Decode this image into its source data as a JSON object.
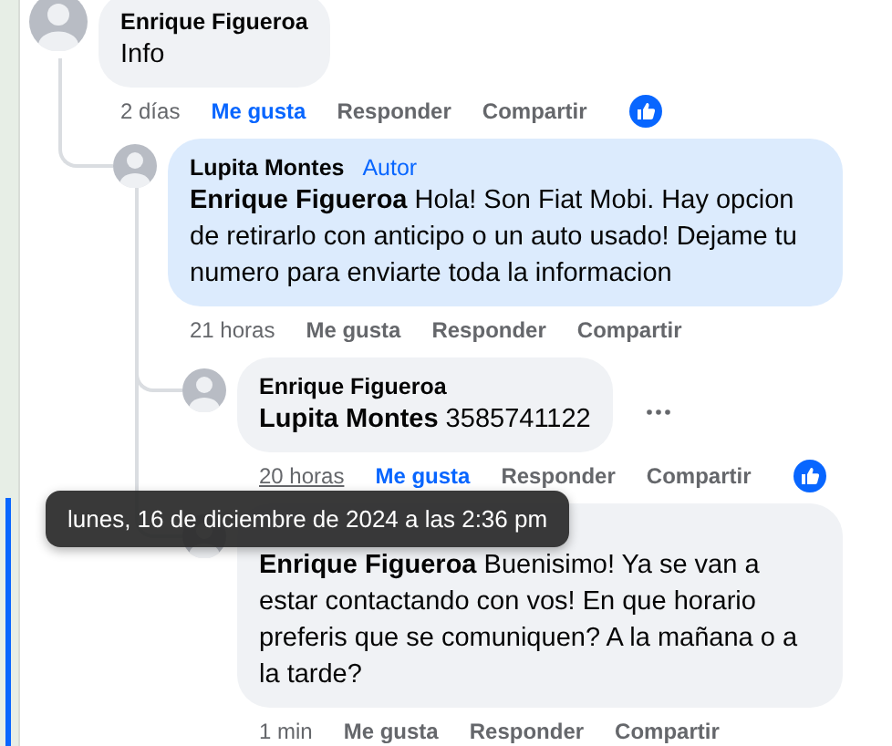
{
  "comments": [
    {
      "author": "Enrique Figueroa",
      "highlighted": false,
      "text": "Info",
      "time": "2 días",
      "time_hovered": false,
      "like": "Me gusta",
      "liked": true,
      "reply": "Responder",
      "share": "Compartir",
      "reaction": true,
      "menu": false,
      "replies": [
        {
          "author": "Lupita Montes",
          "badge": "Autor",
          "highlighted": true,
          "mention": "Enrique Figueroa",
          "text": "Hola! Son Fiat Mobi. Hay opcion de retirarlo con anticipo o un auto usado! Dejame tu numero para enviarte toda la informacion",
          "time": "21 horas",
          "time_hovered": false,
          "like": "Me gusta",
          "liked": false,
          "reply": "Responder",
          "share": "Compartir",
          "reaction": false,
          "menu": false,
          "replies": [
            {
              "author": "Enrique Figueroa",
              "highlighted": false,
              "mention": "Lupita Montes",
              "text": "3585741122",
              "time": "20 horas",
              "time_hovered": true,
              "like": "Me gusta",
              "liked": true,
              "reply": "Responder",
              "share": "Compartir",
              "reaction": true,
              "menu": true
            },
            {
              "highlighted": false,
              "mention": "Enrique Figueroa",
              "text": "Buenisimo! Ya se van a estar contactando con vos! En que horario preferis que se comuniquen? A la mañana o a la tarde?",
              "time": "1 min",
              "time_hovered": false,
              "like": "Me gusta",
              "liked": false,
              "reply": "Responder",
              "share": "Compartir",
              "reaction": false,
              "menu": false
            }
          ]
        }
      ]
    }
  ],
  "tooltip": "lunes, 16 de diciembre de 2024 a las 2:36 pm"
}
